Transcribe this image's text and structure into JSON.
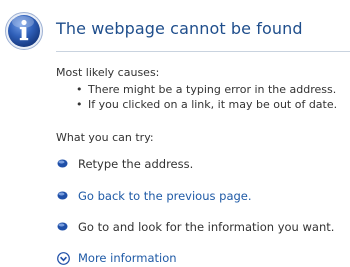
{
  "page": {
    "title": "The webpage cannot be found",
    "icon": "info-icon"
  },
  "causes": {
    "heading": "Most likely causes:",
    "items": [
      "There might be a typing error in the address.",
      "If you clicked on a link, it may be out of date."
    ]
  },
  "actions": {
    "heading": "What you can try:",
    "items": [
      {
        "label": "Retype the address.",
        "link": false
      },
      {
        "label": "Go back to the previous page.",
        "link": true
      },
      {
        "label": "Go to  and look for the information you want.",
        "link": false
      }
    ]
  },
  "more_info": {
    "label": "More information",
    "icon": "expand-down-icon"
  },
  "colors": {
    "title": "#1f4e8c",
    "link": "#1f5aa6",
    "bullet": "#1f4fa8",
    "icon_blue": "#2f5fb8"
  }
}
